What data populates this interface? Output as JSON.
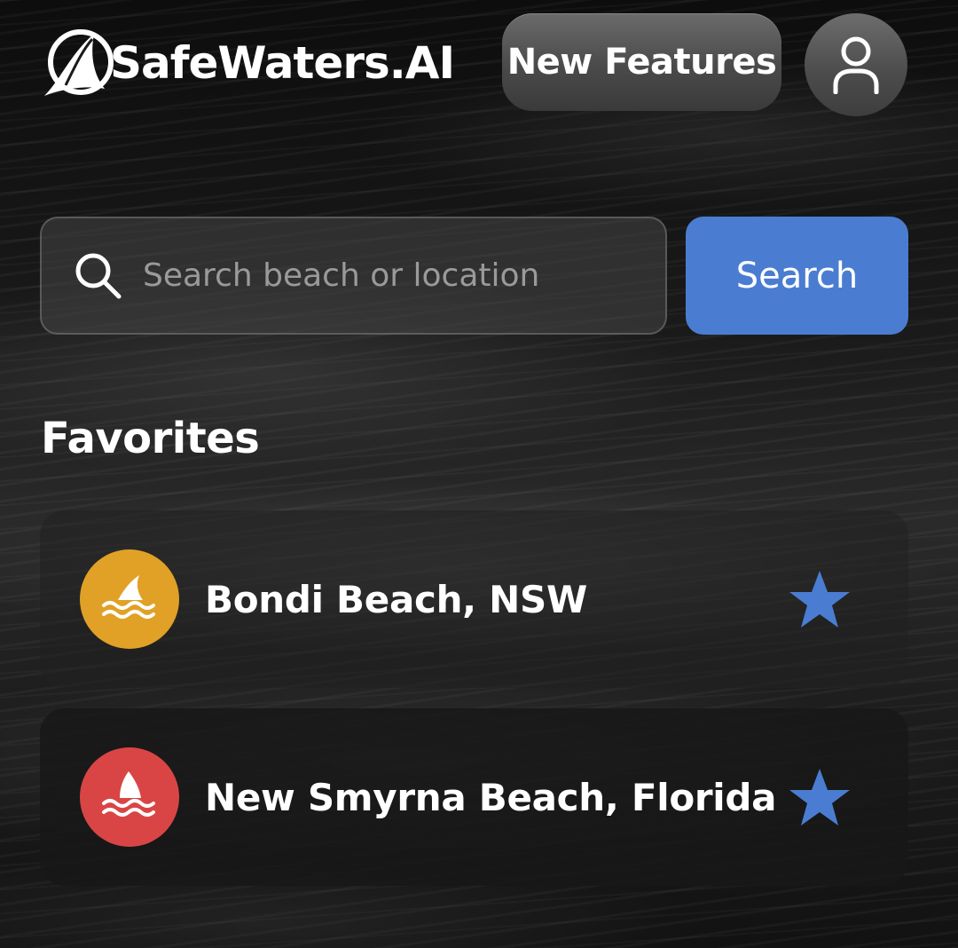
{
  "header": {
    "logo_text": "SafeWaters.AI",
    "new_features_label": "New Features",
    "profile_icon": "user-icon"
  },
  "search": {
    "placeholder": "Search beach or location",
    "value": "",
    "button_label": "Search",
    "icon": "search-icon"
  },
  "favorites": {
    "title": "Favorites",
    "items": [
      {
        "name": "Bondi Beach, NSW",
        "badge_color": "#e0a126",
        "icon": "shark-fin-waves-icon",
        "starred": true
      },
      {
        "name": "New Smyrna Beach, Florida",
        "badge_color": "#d94545",
        "icon": "shark-fin-waves-icon",
        "starred": true
      }
    ]
  },
  "colors": {
    "accent": "#4a7dd1",
    "star": "#4a7dd1",
    "risk_medium": "#e0a126",
    "risk_high": "#d94545"
  }
}
